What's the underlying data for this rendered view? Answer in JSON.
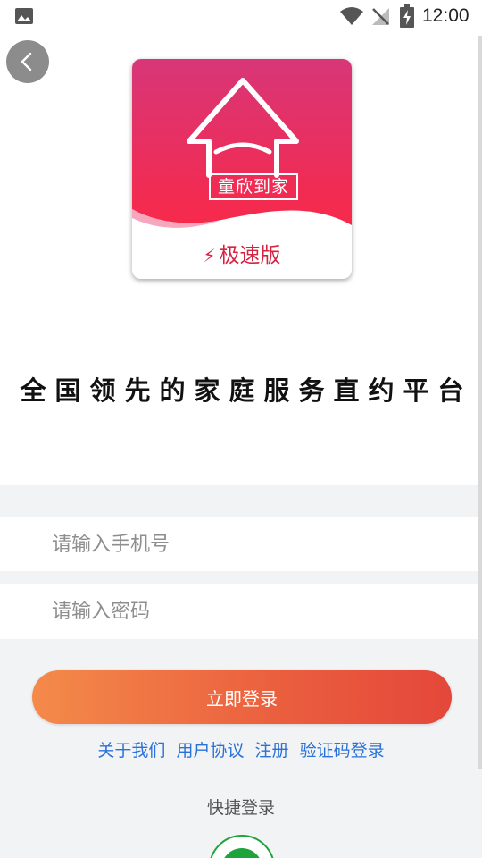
{
  "status_bar": {
    "time": "12:00"
  },
  "logo": {
    "brand_text": "童欣到家",
    "edition_text": "极速版",
    "bolt_icon": "⚡"
  },
  "slogan": "全国领先的家庭服务直约平台",
  "form": {
    "phone_placeholder": "请输入手机号",
    "password_placeholder": "请输入密码",
    "login_label": "立即登录"
  },
  "links": {
    "about": "关于我们",
    "agreement": "用户协议",
    "register": "注册",
    "code_login": "验证码登录"
  },
  "quick_login": {
    "title": "快捷登录"
  },
  "colors": {
    "brand_pink": "#e0356a",
    "brand_red": "#f2334c",
    "accent_orange": "#f48a4a",
    "accent_red": "#e4473a",
    "link_blue": "#2a72d8",
    "wechat_green": "#1ea43b"
  }
}
